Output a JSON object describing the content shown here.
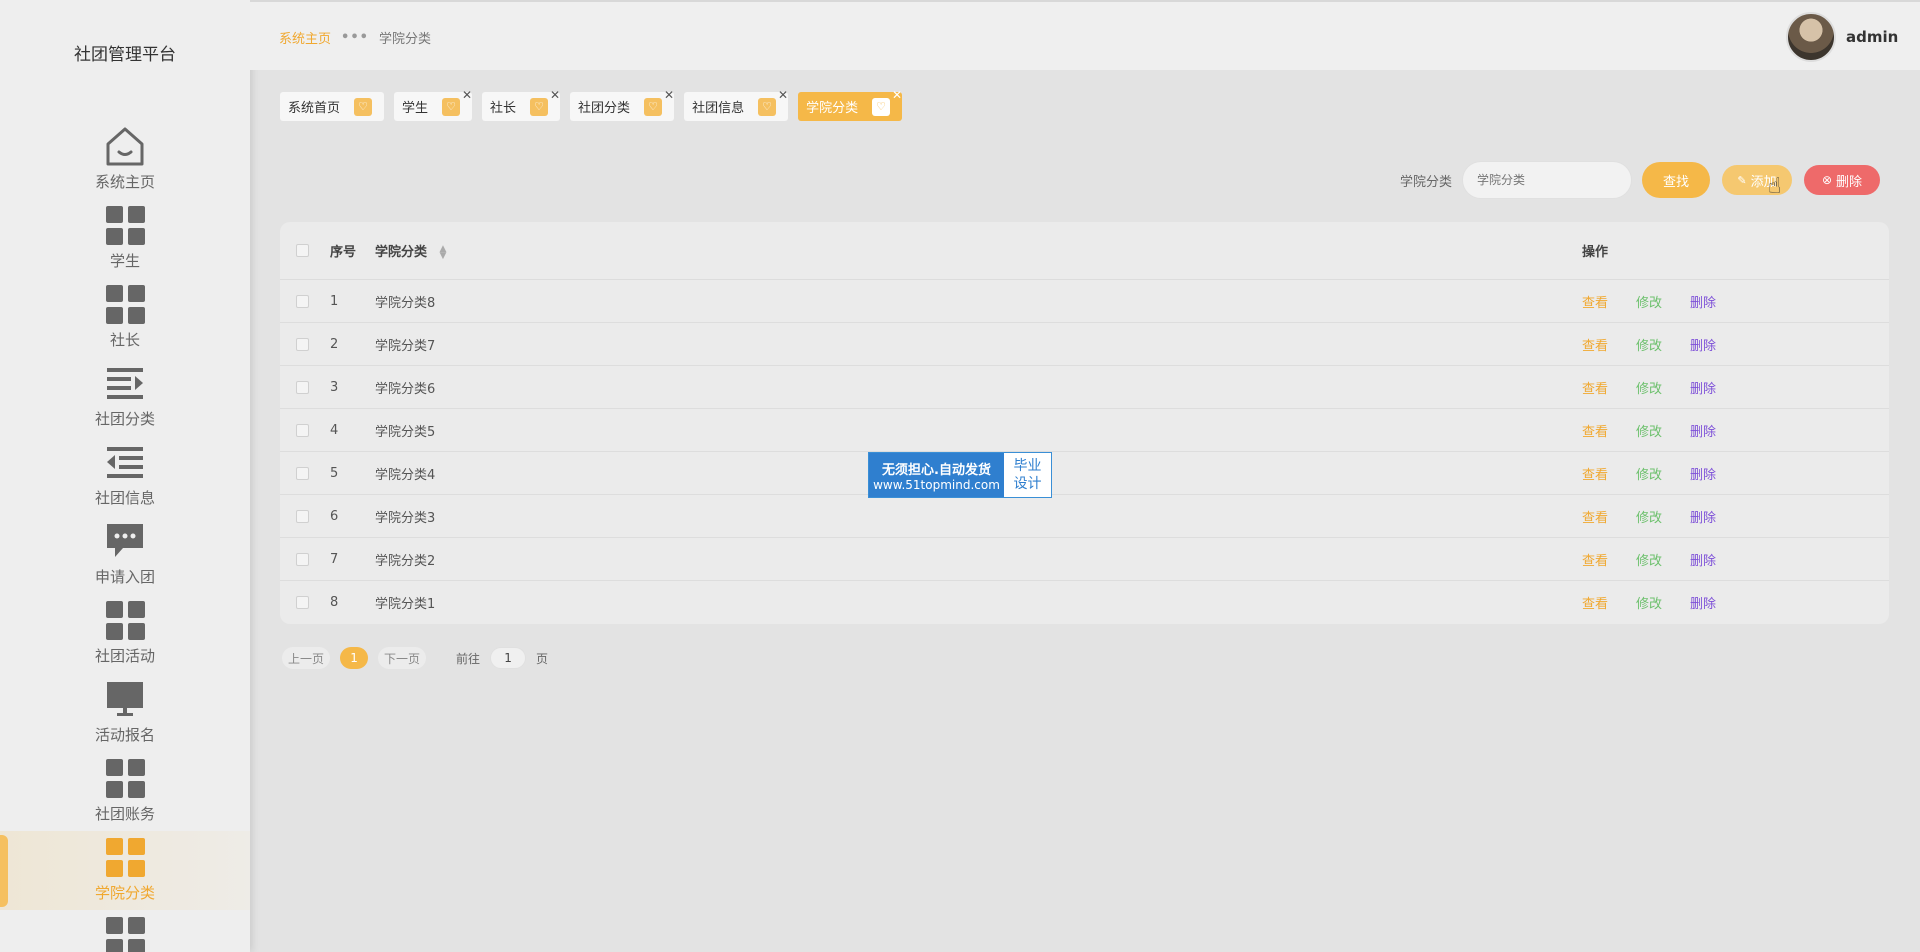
{
  "sidebar": {
    "brand": "社团管理平台",
    "items": [
      {
        "label": "系统主页",
        "icon": "home-icon"
      },
      {
        "label": "学生",
        "icon": "grid-icon"
      },
      {
        "label": "社长",
        "icon": "grid-icon"
      },
      {
        "label": "社团分类",
        "icon": "list-indent-icon"
      },
      {
        "label": "社团信息",
        "icon": "list-outdent-icon"
      },
      {
        "label": "申请入团",
        "icon": "chat-icon"
      },
      {
        "label": "社团活动",
        "icon": "grid-icon"
      },
      {
        "label": "活动报名",
        "icon": "monitor-icon"
      },
      {
        "label": "社团账务",
        "icon": "grid-icon"
      },
      {
        "label": "学院分类",
        "icon": "grid-icon",
        "active": true
      }
    ]
  },
  "header": {
    "breadcrumb_home": "系统主页",
    "breadcrumb_current": "学院分类",
    "username": "admin"
  },
  "tags": [
    {
      "label": "系统首页",
      "closable": false
    },
    {
      "label": "学生",
      "closable": true
    },
    {
      "label": "社长",
      "closable": true
    },
    {
      "label": "社团分类",
      "closable": true
    },
    {
      "label": "社团信息",
      "closable": true
    },
    {
      "label": "学院分类",
      "closable": true,
      "active": true
    }
  ],
  "search": {
    "label": "学院分类",
    "placeholder": "学院分类",
    "find_label": "查找",
    "add_label": "添加",
    "delete_label": "删除"
  },
  "table": {
    "headers": {
      "index": "序号",
      "name": "学院分类",
      "ops": "操作"
    },
    "rows": [
      {
        "index": "1",
        "name": "学院分类8"
      },
      {
        "index": "2",
        "name": "学院分类7"
      },
      {
        "index": "3",
        "name": "学院分类6"
      },
      {
        "index": "4",
        "name": "学院分类5"
      },
      {
        "index": "5",
        "name": "学院分类4"
      },
      {
        "index": "6",
        "name": "学院分类3"
      },
      {
        "index": "7",
        "name": "学院分类2"
      },
      {
        "index": "8",
        "name": "学院分类1"
      }
    ],
    "ops": {
      "view": "查看",
      "edit": "修改",
      "delete": "删除"
    }
  },
  "pager": {
    "prev": "上一页",
    "current": "1",
    "next": "下一页",
    "goto": "前往",
    "page_input": "1",
    "page_suffix": "页"
  },
  "watermark": {
    "line1": "无须担心.自动发货",
    "line2": "www.51topmind.com",
    "right1": "毕业",
    "right2": "设计"
  },
  "colors": {
    "accent": "#f5b848",
    "danger": "#ee6a6a",
    "edit": "#6cc06c",
    "delete_link": "#7d4fd8"
  }
}
